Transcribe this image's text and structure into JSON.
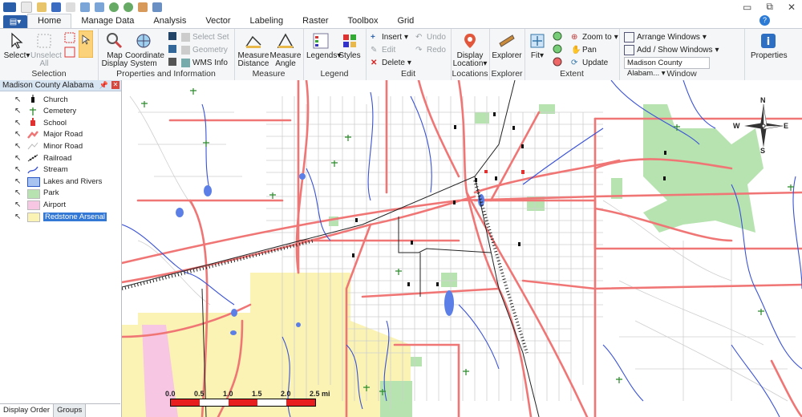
{
  "ribbon_tabs": [
    "Home",
    "Manage Data",
    "Analysis",
    "Vector",
    "Labeling",
    "Raster",
    "Toolbox",
    "Grid"
  ],
  "groups": {
    "selection": {
      "label": "Selection",
      "select": "Select",
      "unselect_all": "Unselect\nAll"
    },
    "props": {
      "label": "Properties and Information",
      "map_display": "Map\nDisplay",
      "coordinate_system": "Coordinate\nSystem",
      "select_set": "Select Set",
      "geometry": "Geometry",
      "wms_info": "WMS Info"
    },
    "measure": {
      "label": "Measure",
      "measure_distance": "Measure\nDistance",
      "measure_angle": "Measure\nAngle"
    },
    "legend": {
      "label": "Legend",
      "legends": "Legends",
      "styles": "Styles"
    },
    "edit": {
      "label": "Edit",
      "insert": "Insert",
      "edit": "Edit",
      "delete": "Delete",
      "undo": "Undo",
      "redo": "Redo"
    },
    "locations": {
      "label": "Locations",
      "display_location": "Display\nLocation"
    },
    "explorer": {
      "label": "Explorer",
      "explorer": "Explorer"
    },
    "extent": {
      "label": "Extent",
      "fit": "Fit",
      "zoom_to": "Zoom to",
      "pan": "Pan",
      "update": "Update"
    },
    "window": {
      "label": "Window",
      "arrange": "Arrange Windows",
      "add_show": "Add / Show Windows",
      "current": "Madison County Alabam...",
      "properties": "Properties"
    }
  },
  "panel": {
    "title": "Madison County Alabama",
    "layers": [
      {
        "name": "Church",
        "type": "church"
      },
      {
        "name": "Cemetery",
        "type": "cemetery"
      },
      {
        "name": "School",
        "type": "school"
      },
      {
        "name": "Major Road",
        "type": "major"
      },
      {
        "name": "Minor Road",
        "type": "minor"
      },
      {
        "name": "Railroad",
        "type": "rail"
      },
      {
        "name": "Stream",
        "type": "stream"
      },
      {
        "name": "Lakes and Rivers",
        "type": "lake"
      },
      {
        "name": "Park",
        "type": "park"
      },
      {
        "name": "Airport",
        "type": "airport"
      },
      {
        "name": "Redstone Arsenal",
        "type": "arsenal",
        "selected": true
      }
    ],
    "tabs": [
      "Display Order",
      "Groups"
    ]
  },
  "map": {
    "scale_labels": [
      "0.0",
      "0.5",
      "1.0",
      "1.5",
      "2.0",
      "2.5 mi"
    ],
    "compass": {
      "n": "N",
      "s": "S",
      "e": "E",
      "w": "W"
    },
    "colors": {
      "major": "#f07676",
      "minor": "#c8c8c8",
      "stream": "#3a52d6",
      "park": "#b7e3b0",
      "arsenal": "#fbf3b3",
      "airport": "#f6c6e3",
      "lake": "#5b7fe6"
    }
  },
  "window_controls": [
    "▭",
    "⧉",
    "✕"
  ]
}
